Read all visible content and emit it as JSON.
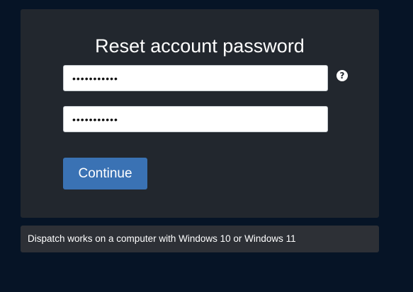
{
  "form": {
    "title": "Reset account password",
    "password_value": "•••••••••••",
    "confirm_password_value": "•••••••••••",
    "help_icon_glyph": "?",
    "continue_label": "Continue"
  },
  "notice": {
    "text": "Dispatch works on a computer with Windows 10 or Windows 11"
  },
  "colors": {
    "page_background": "#061426",
    "card_background": "#22272e",
    "button": "#3a72b4",
    "notice_background": "#2d3036"
  }
}
